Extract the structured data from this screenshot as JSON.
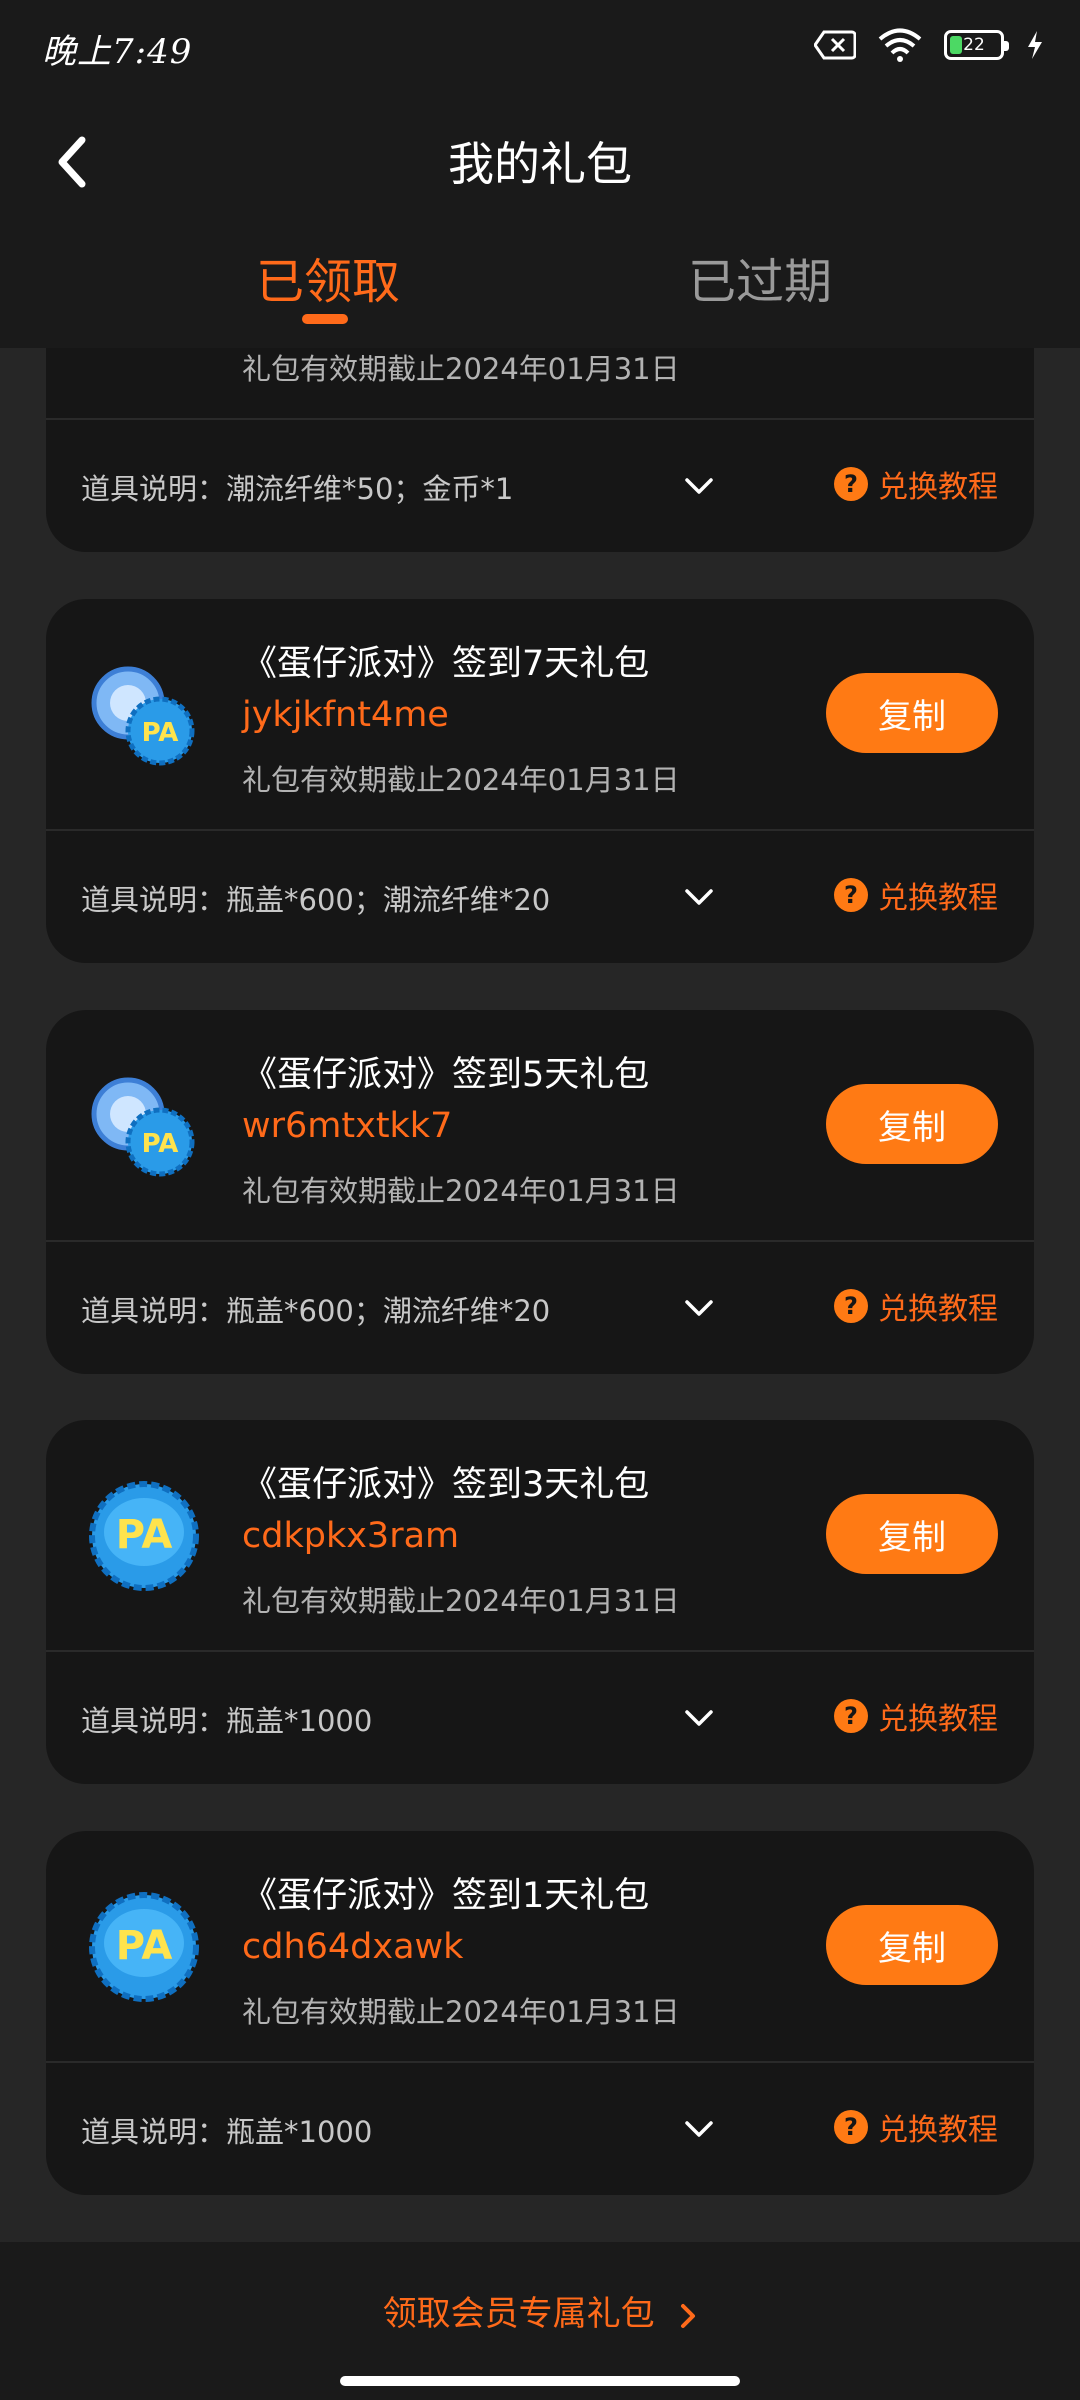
{
  "status_bar": {
    "time": "晚上7:49",
    "battery_level": "22"
  },
  "header": {
    "title": "我的礼包",
    "tabs": [
      {
        "label": "已领取",
        "active": true
      },
      {
        "label": "已过期",
        "active": false
      }
    ]
  },
  "gifts": [
    {
      "name": "",
      "code": "",
      "expiry": "礼包有效期截止2024年01月31日",
      "description": "道具说明：潮流纤维*50；金币*1",
      "icon": "gold-coin-icon"
    },
    {
      "name": "《蛋仔派对》签到7天礼包",
      "code": "jykjkfnt4me",
      "expiry": "礼包有效期截止2024年01月31日",
      "copy_label": "复制",
      "description": "道具说明：瓶盖*600；潮流纤维*20",
      "tutorial_label": "兑换教程",
      "icon": "bottle-cap-fiber-icon"
    },
    {
      "name": "《蛋仔派对》签到5天礼包",
      "code": "wr6mtxtkk7",
      "expiry": "礼包有效期截止2024年01月31日",
      "copy_label": "复制",
      "description": "道具说明：瓶盖*600；潮流纤维*20",
      "tutorial_label": "兑换教程",
      "icon": "bottle-cap-fiber-icon"
    },
    {
      "name": "《蛋仔派对》签到3天礼包",
      "code": "cdkpkx3ram",
      "expiry": "礼包有效期截止2024年01月31日",
      "copy_label": "复制",
      "description": "道具说明：瓶盖*1000",
      "tutorial_label": "兑换教程",
      "icon": "bottle-cap-icon"
    },
    {
      "name": "《蛋仔派对》签到1天礼包",
      "code": "cdh64dxawk",
      "expiry": "礼包有效期截止2024年01月31日",
      "copy_label": "复制",
      "description": "道具说明：瓶盖*1000",
      "tutorial_label": "兑换教程",
      "icon": "bottle-cap-icon"
    }
  ],
  "first_card_tutorial_label": "兑换教程",
  "footer": {
    "vip_link": "领取会员专属礼包"
  },
  "colors": {
    "accent": "#ff7a14",
    "background": "#262626",
    "card": "#161616"
  }
}
